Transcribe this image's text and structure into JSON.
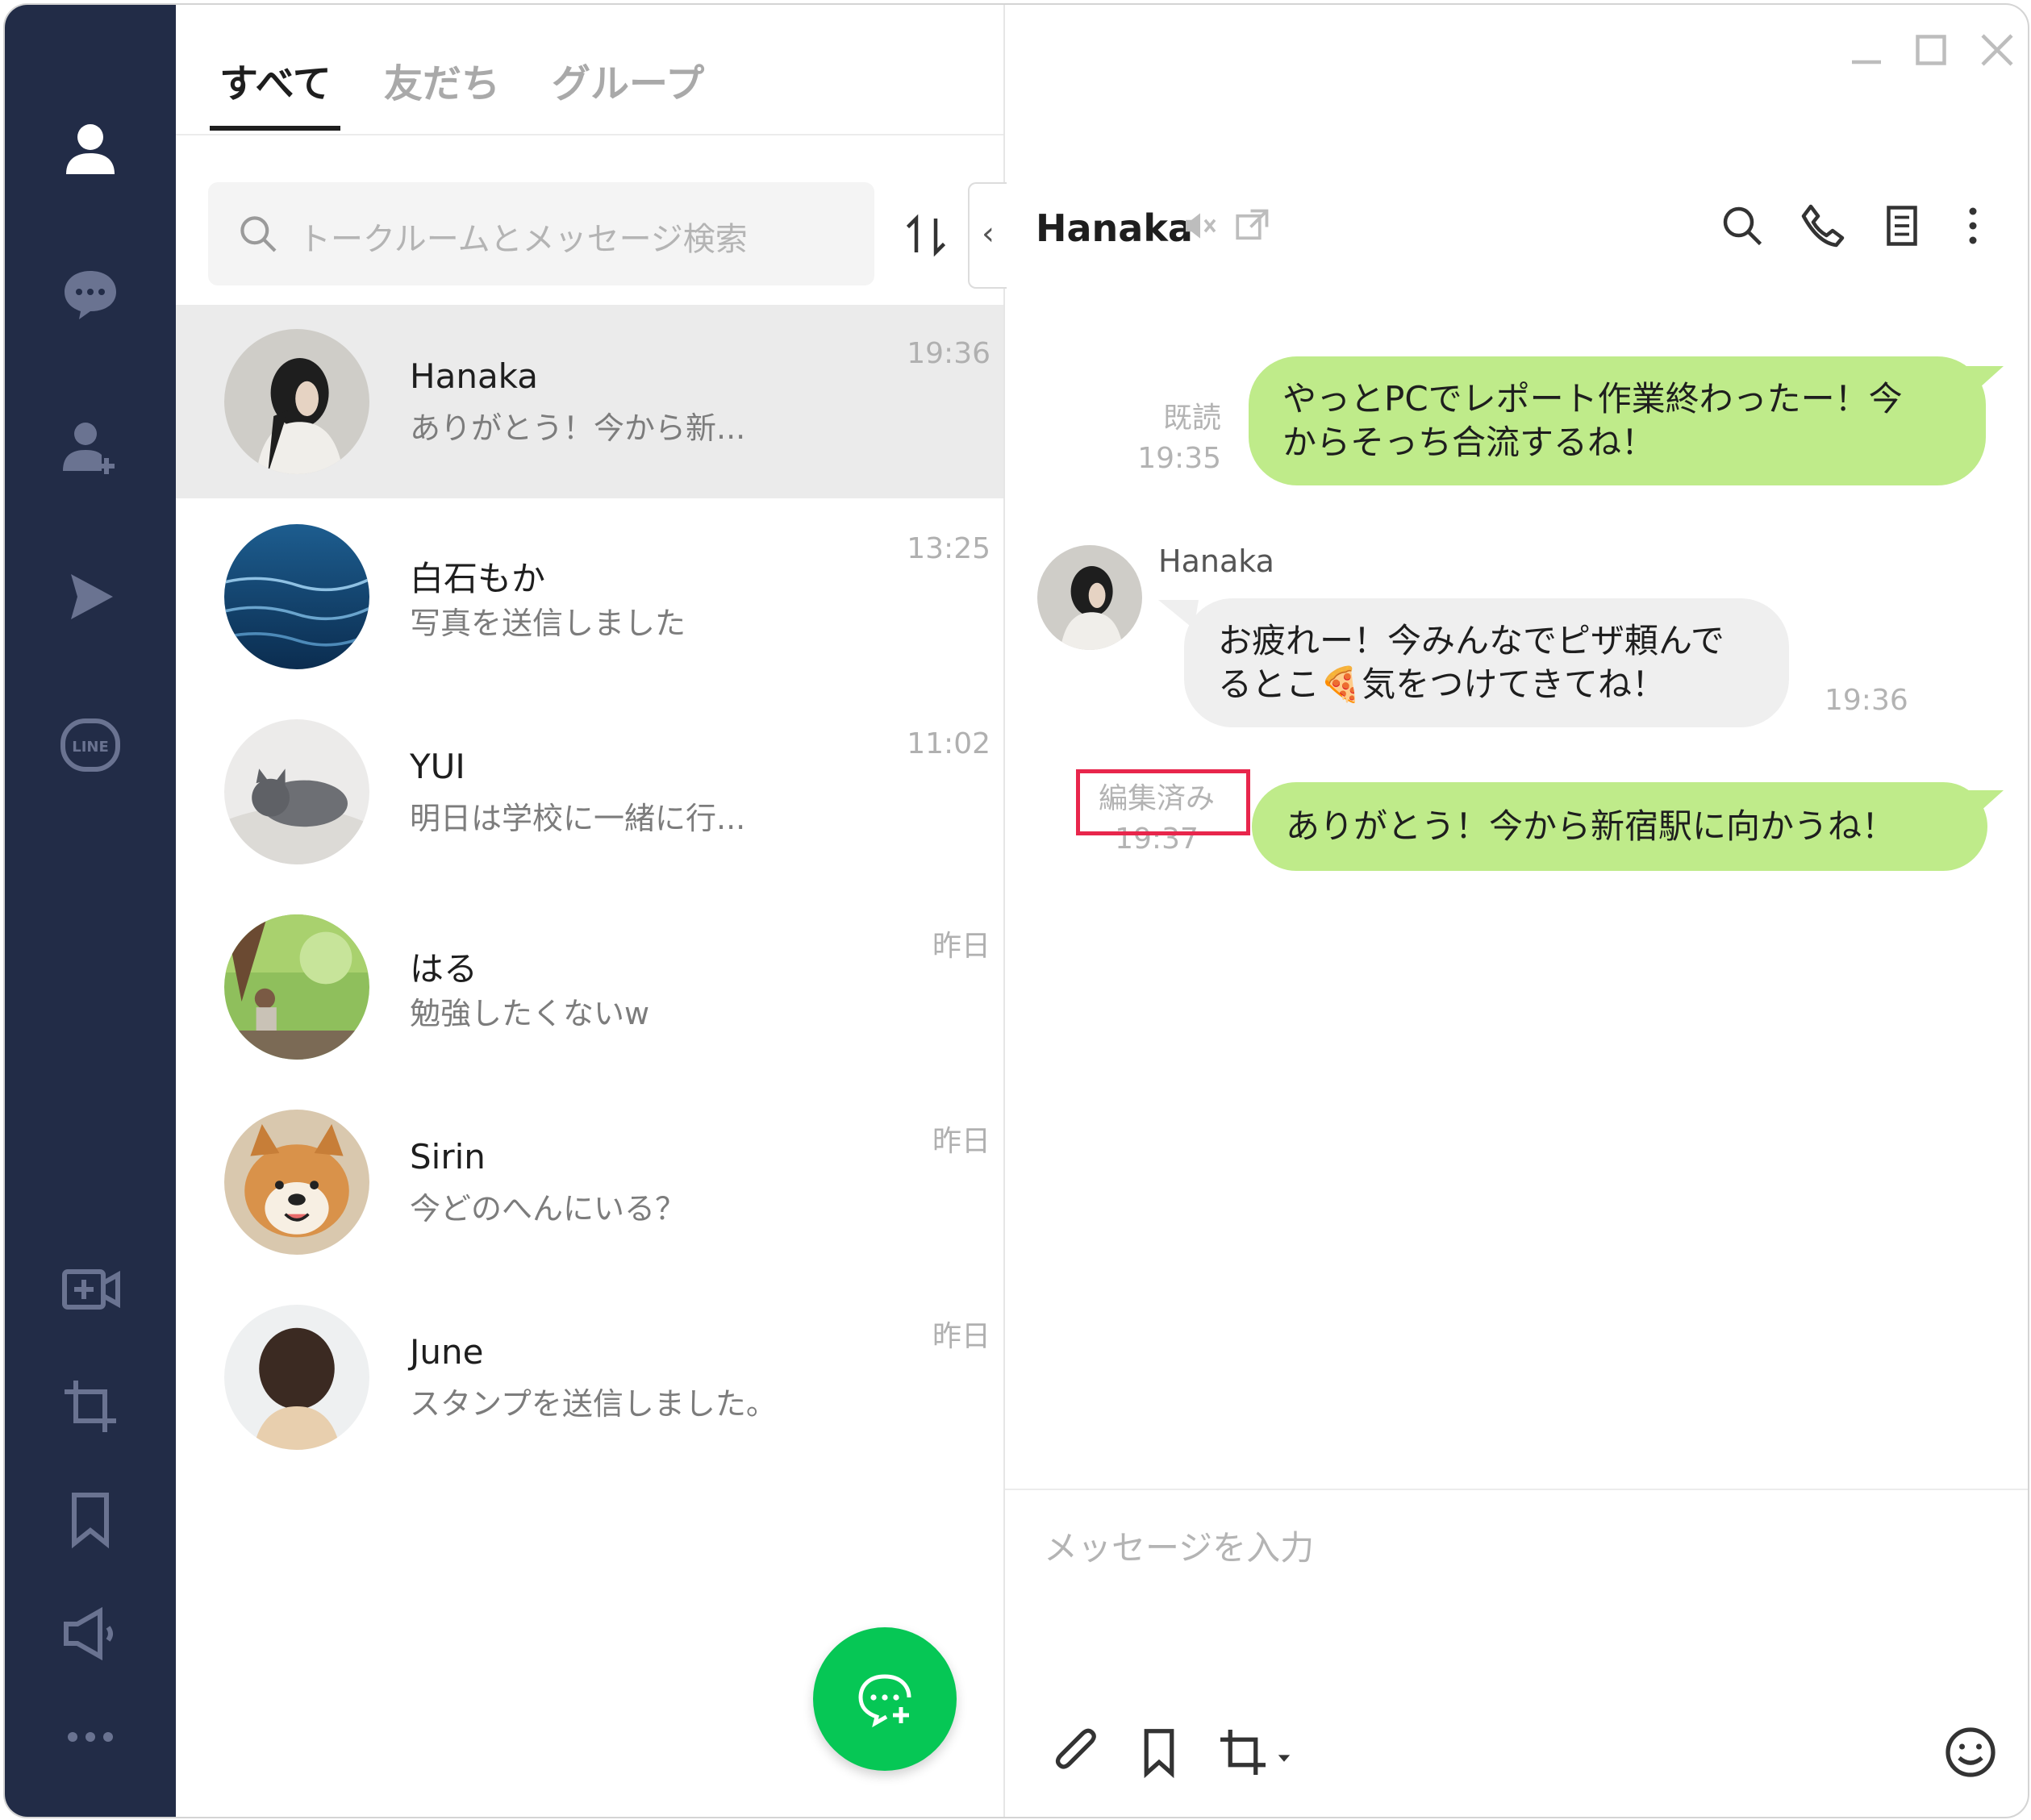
{
  "nav": {
    "icons": [
      "friends-icon",
      "chats-icon",
      "add-friend-icon",
      "keep-icon",
      "line-icon",
      "video-call-icon",
      "screenshot-icon",
      "bookmark-icon",
      "announcement-icon",
      "more-icon"
    ],
    "bg_color": "#222c47"
  },
  "tabs": [
    {
      "label": "すべて",
      "active": true
    },
    {
      "label": "友だち",
      "active": false
    },
    {
      "label": "グループ",
      "active": false
    }
  ],
  "search": {
    "placeholder": "トークルームとメッセージ検索"
  },
  "collapse_label": "‹",
  "chats": [
    {
      "name": "Hanaka",
      "preview": "ありがとう！今から新...",
      "time": "19:36",
      "selected": true
    },
    {
      "name": "白石もか",
      "preview": "写真を送信しました",
      "time": "13:25",
      "selected": false
    },
    {
      "name": "YUI",
      "preview": "明日は学校に一緒に行...",
      "time": "11:02",
      "selected": false
    },
    {
      "name": "はる",
      "preview": "勉強したくないw",
      "time": "昨日",
      "selected": false
    },
    {
      "name": "Sirin",
      "preview": "今どのへんにいる？",
      "time": "昨日",
      "selected": false
    },
    {
      "name": "June",
      "preview": "スタンプを送信しました。",
      "time": "昨日",
      "selected": false
    }
  ],
  "conversation": {
    "title": "Hanaka",
    "messages": {
      "m1": {
        "line1": "やっとPCでレポート作業終わったー！今",
        "line2": "からそっち合流するね！",
        "read": "既読",
        "time": "19:35"
      },
      "m2": {
        "sender": "Hanaka",
        "line1": "お疲れー！今みんなでピザ頼んで",
        "line2": "るとこ🍕気をつけてきてね！",
        "time": "19:36"
      },
      "m3": {
        "text": "ありがとう！今から新宿駅に向かうね！",
        "edited": "編集済み",
        "time": "19:37"
      }
    },
    "composer_placeholder": "メッセージを入力"
  },
  "colors": {
    "accent_green": "#06c755",
    "bubble_out": "#bfeb8a",
    "bubble_in": "#efefef",
    "highlight": "#e8264c"
  }
}
